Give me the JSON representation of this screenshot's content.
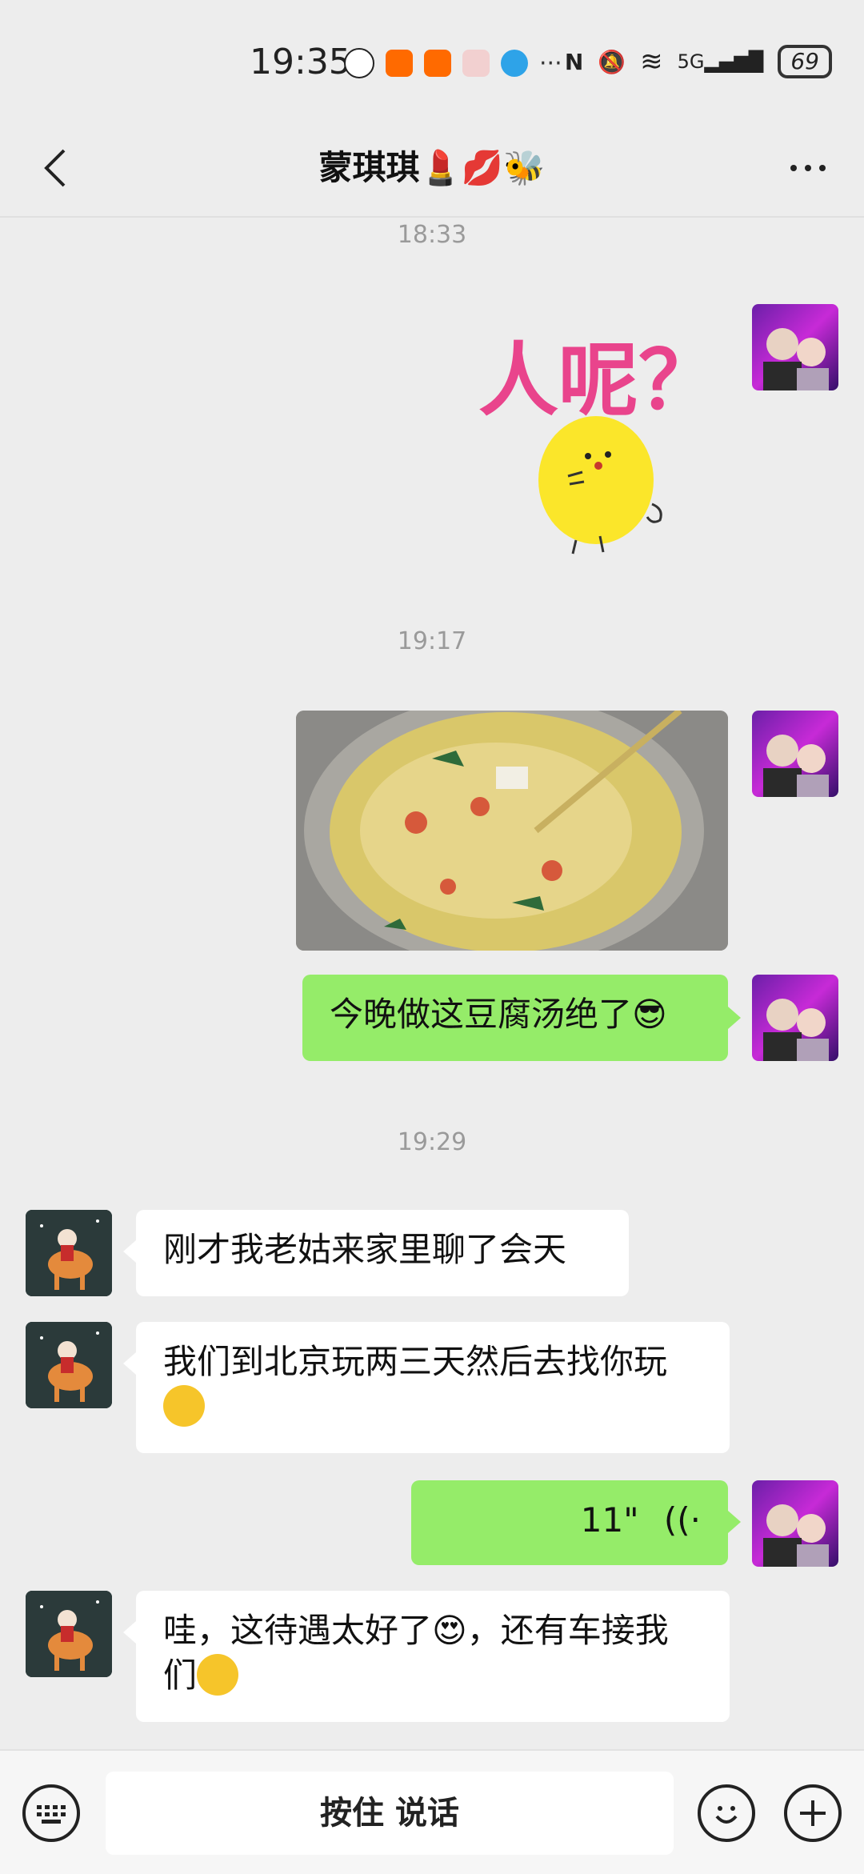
{
  "status_bar": {
    "time": "19:35",
    "network": "5G",
    "battery": "69"
  },
  "nav": {
    "title": "蒙琪琪💄💋🐝"
  },
  "messages": {
    "ts1": "18:33",
    "sticker_text": "人呢？",
    "ts2": "19:17",
    "msg_tofu": "今晚做这豆腐汤绝了😎",
    "ts3": "19:29",
    "msg_aunt": "刚才我老姑来家里聊了会天",
    "msg_beijing": "我们到北京玩两三天然后去找你玩",
    "voice_duration": "11\"",
    "msg_wow_a": "哇，这待遇太好了😍，还有车接我",
    "msg_wow_b": "们"
  },
  "input": {
    "talk_label": "按住 说话"
  },
  "colors": {
    "my_bubble": "#95ec69",
    "friend_bubble": "#ffffff",
    "background": "#ededed"
  }
}
